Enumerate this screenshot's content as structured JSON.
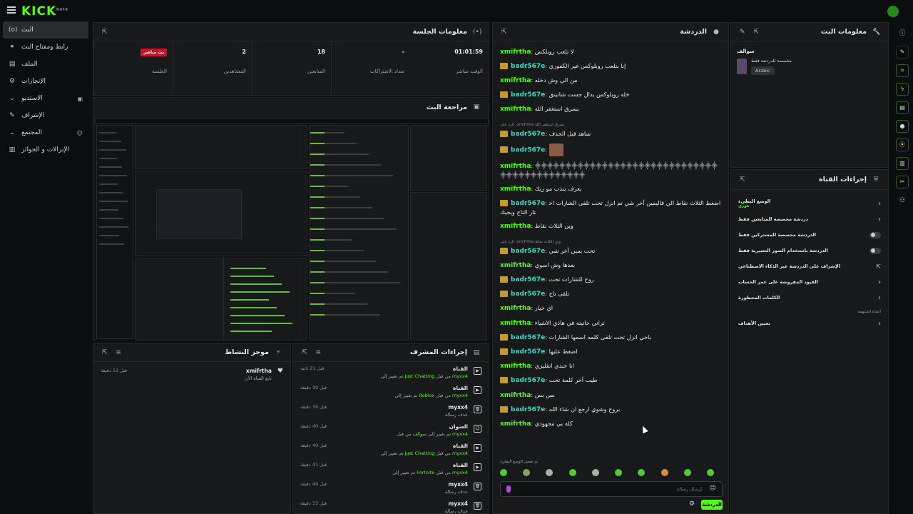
{
  "brand": {
    "logo": "KICK",
    "logo_sup": "beta"
  },
  "sidebar": {
    "items": [
      {
        "label": "البث",
        "icon": "(o)",
        "active": true,
        "chevron": ""
      },
      {
        "label": "رابط ومفتاح البث",
        "icon": "⚭",
        "chevron": ""
      },
      {
        "label": "الملف",
        "icon": "▤",
        "chevron": ""
      },
      {
        "label": "الإنجازات",
        "icon": "⚙",
        "chevron": ""
      },
      {
        "label": "الاستديو",
        "icon": "▣",
        "chevron": "⌄"
      },
      {
        "label": "الإشراف",
        "icon": "✎",
        "chevron": ""
      },
      {
        "label": "المجتمع",
        "icon": "☺",
        "chevron": "⌄"
      },
      {
        "label": "الإنزالات و الجوائز",
        "icon": "▥",
        "chevron": ""
      }
    ]
  },
  "session": {
    "title": "معلومات الجلسة",
    "stats": [
      {
        "value": "01:01:59",
        "label": "الوقت مباشر"
      },
      {
        "value": "-",
        "label": "تعداد الاشتراكات"
      },
      {
        "value": "18",
        "label": "المتابعين"
      },
      {
        "value": "2",
        "label": "المشاهدين"
      },
      {
        "value": "بث مباشر",
        "label": "الجلسة",
        "is_badge": true
      }
    ]
  },
  "preview": {
    "title": "مراجعة البث"
  },
  "activity": {
    "title": "موجز النشاط",
    "items": [
      {
        "name": "xmifrtha",
        "desc": "تابع القناة الآن",
        "time": "قبل 51 دقيقة"
      }
    ]
  },
  "mod_actions": {
    "title": "إجراءات المشرف",
    "items": [
      {
        "name": "القناة",
        "desc_pre": "",
        "desc_hl": "Just Chatting",
        "desc_mid": " من قبل ",
        "desc_user": "myxx4",
        "desc_post": "تم تغيير إلى ",
        "time": "قبل 21 ثانية",
        "icon": "▶"
      },
      {
        "name": "القناة",
        "desc_pre": "",
        "desc_hl": "Roblox",
        "desc_mid": " من قبل ",
        "desc_user": "myxx4",
        "desc_post": "تم تغيير إلى ",
        "time": "قبل 39 دقيقة",
        "icon": "▶"
      },
      {
        "name": "myxx4",
        "desc_pre": "حذف رسالة",
        "desc_hl": "",
        "desc_mid": "",
        "desc_user": "",
        "desc_post": "",
        "time": "قبل 39 دقيقة",
        "icon": "🗑"
      },
      {
        "name": "العنوان",
        "desc_pre": "",
        "desc_hl": "سوالف",
        "desc_mid": " من قبل ",
        "desc_user": "myxx4",
        "desc_post": "تم تغيير إلى ",
        "time": "قبل 40 دقيقة",
        "icon": "☺"
      },
      {
        "name": "القناة",
        "desc_pre": "",
        "desc_hl": "Just Chatting",
        "desc_mid": " من قبل ",
        "desc_user": "myxx4",
        "desc_post": "تم تغيير إلى ",
        "time": "قبل 40 دقيقة",
        "icon": "▶"
      },
      {
        "name": "القناة",
        "desc_pre": "",
        "desc_hl": "Fortnite",
        "desc_mid": " من قبل ",
        "desc_user": "myxx4",
        "desc_post": "تم تغيير إلى ",
        "time": "قبل 41 دقيقة",
        "icon": "▶"
      },
      {
        "name": "myxx4",
        "desc_pre": "حذف رسالة",
        "desc_hl": "",
        "desc_mid": "",
        "desc_user": "",
        "desc_post": "",
        "time": "قبل 49 دقيقة",
        "icon": "🗑"
      },
      {
        "name": "myxx4",
        "desc_pre": "حذف رسالة",
        "desc_hl": "",
        "desc_mid": "",
        "desc_user": "",
        "desc_post": "",
        "time": "قبل 53 دقيقة",
        "icon": "🗑"
      }
    ]
  },
  "chat": {
    "title": "الدردشة",
    "messages": [
      {
        "user": "xmifrtha",
        "color": "#53fc18",
        "badge": false,
        "text": "لا تلعب روبلكس"
      },
      {
        "user": "badr567e",
        "color": "#3fd8c0",
        "badge": true,
        "text": "إنا بتلعب روبلوكس غير الكفوري"
      },
      {
        "user": "xmifrtha",
        "color": "#53fc18",
        "badge": false,
        "text": "من الي وش دخله"
      },
      {
        "user": "badr567e",
        "color": "#3fd8c0",
        "badge": true,
        "text": "خله روبلوكس بدال جست شاتينق"
      },
      {
        "user": "xmifrtha",
        "color": "#53fc18",
        "badge": false,
        "text": "يسرق استغفر الله"
      },
      {
        "user": "badr567e",
        "color": "#3fd8c0",
        "badge": true,
        "text": "شاهد قبل الحذف",
        "reply": "الرد على :xmifrtha يسرق استغفر الله"
      },
      {
        "user": "badr567e",
        "color": "#3fd8c0",
        "badge": true,
        "text": "",
        "emote": true
      },
      {
        "user": "xmifrtha",
        "color": "#53fc18",
        "badge": false,
        "text": "⸎⸎⸎⸎⸎⸎⸎⸎⸎⸎⸎⸎⸎⸎⸎⸎⸎⸎⸎⸎⸎⸎⸎⸎⸎⸎⸎⸎⸎⸎⸎⸎⸎⸎⸎⸎⸎⸎⸎⸎⸎⸎⸎⸎"
      },
      {
        "user": "xmifrtha",
        "color": "#53fc18",
        "badge": false,
        "text": "يعرف ينذب مو زيك"
      },
      {
        "user": "badr567e",
        "color": "#3fd8c0",
        "badge": true,
        "text": "اضغط الثلاث نقاط الي فاليمين آخر شي تم انزل تحت تلقى الشارات اختار التاج ويجيك"
      },
      {
        "user": "xmifrtha",
        "color": "#53fc18",
        "badge": false,
        "text": "وين الثلاث نقاط"
      },
      {
        "user": "badr567e",
        "color": "#3fd8c0",
        "badge": true,
        "text": "تحت يمين آخر شي",
        "reply": "الرد على :xmifrtha وين الثلاث نقاط"
      },
      {
        "user": "xmifrtha",
        "color": "#53fc18",
        "badge": false,
        "text": "بعدها وش اسوي"
      },
      {
        "user": "badr567e",
        "color": "#3fd8c0",
        "badge": true,
        "text": "روح للشارات تحت"
      },
      {
        "user": "badr567e",
        "color": "#3fd8c0",
        "badge": true,
        "text": "تلقى تاج"
      },
      {
        "user": "xmifrtha",
        "color": "#53fc18",
        "badge": false,
        "text": "اي خيار"
      },
      {
        "user": "xmifrtha",
        "color": "#53fc18",
        "badge": false,
        "text": "تراني حاتيته في هاذي الاشياء"
      },
      {
        "user": "badr567e",
        "color": "#3fd8c0",
        "badge": true,
        "text": "ياخي انزل تحت تلقى كلمه اسمها الشارات"
      },
      {
        "user": "badr567e",
        "color": "#3fd8c0",
        "badge": true,
        "text": "اضغط عليها"
      },
      {
        "user": "xmifrtha",
        "color": "#53fc18",
        "badge": false,
        "text": "انا حندي انقليزي"
      },
      {
        "user": "badr567e",
        "color": "#3fd8c0",
        "badge": true,
        "text": "طيب آخر كلمة تحت"
      },
      {
        "user": "xmifrtha",
        "color": "#53fc18",
        "badge": false,
        "text": "بس بس"
      },
      {
        "user": "badr567e",
        "color": "#3fd8c0",
        "badge": true,
        "text": "بروح وشوي ارجع ان شاء الله"
      },
      {
        "user": "xmifrtha",
        "color": "#53fc18",
        "badge": false,
        "text": "كله بي مجهودي"
      }
    ],
    "mode_note": "تم تفعيل الوضع البطيء",
    "input_placeholder": "إرسال رسالة",
    "send_label": "الدردشة"
  },
  "stream_info": {
    "title": "معلومات البث",
    "stream_title": "سوالف",
    "category": "مخصصة للدردشة فقط",
    "language": "Arabic"
  },
  "channel_actions": {
    "title": "إجراءات القناة",
    "rows": [
      {
        "label": "الوضع البطيء",
        "sub": "فوري",
        "control": "chevron"
      },
      {
        "label": "دردشة مخصصة للمتابعين فقط",
        "control": "chevron"
      },
      {
        "label": "الدردشة مخصصة للمشتركين فقط",
        "control": "toggle"
      },
      {
        "label": "الدردشة باستخدام الصور التعبيرية فقط",
        "control": "toggle"
      },
      {
        "label": "الإشراف على الدردشة عبر الذكاء الاصطناعي",
        "control": "link"
      },
      {
        "label": "القيود المفروضة على عمر الحساب",
        "control": "chevron"
      },
      {
        "label": "الكلمات المحظورة",
        "control": "chevron"
      }
    ],
    "section_label": "القناة المتنهمة",
    "goals_label": "تعيين الأهداف"
  },
  "colors": {
    "accent": "#53fc18",
    "live": "#c4182a",
    "panel": "#17191b",
    "bg": "#0b0e0f"
  }
}
